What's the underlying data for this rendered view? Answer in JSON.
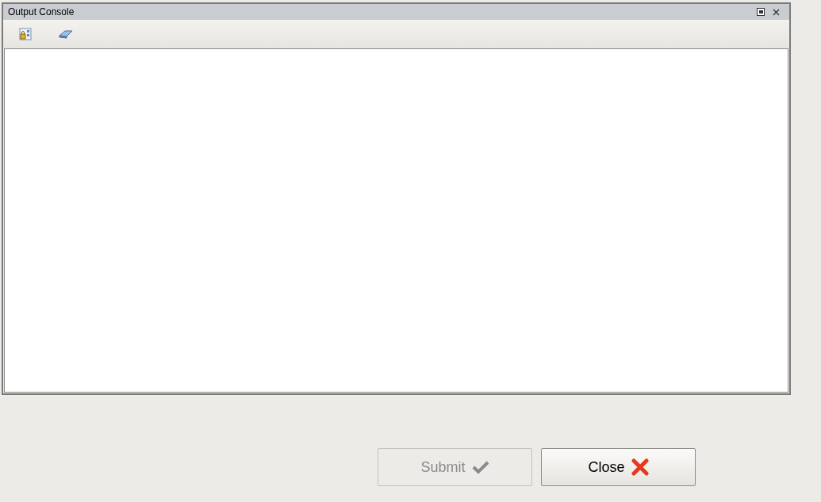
{
  "console": {
    "title": "Output Console"
  },
  "buttons": [
    {
      "kind": "submit",
      "label": "Submit",
      "disabled": true
    },
    {
      "kind": "close",
      "label": "Close",
      "disabled": false
    }
  ]
}
